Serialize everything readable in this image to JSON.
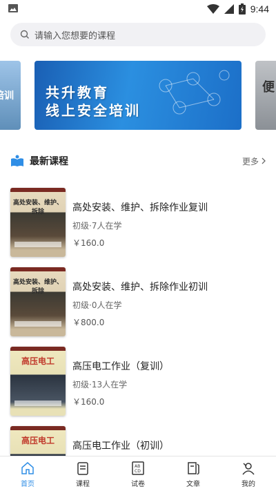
{
  "status_bar": {
    "time": "9:44"
  },
  "search": {
    "placeholder": "请输入您想要的课程"
  },
  "banner": {
    "line1": "共升教育",
    "line2": "线上安全培训",
    "left_peek_text": "培训",
    "right_peek_text": "便"
  },
  "section": {
    "title": "最新课程",
    "more": "更多"
  },
  "courses": [
    {
      "name": "高处安装、维护、拆除作业复训",
      "level": "初级",
      "learners": "·7人在学",
      "price": "￥160.0",
      "cover_title": "高处安装、维护、拆除"
    },
    {
      "name": "高处安装、维护、拆除作业初训",
      "level": "初级",
      "learners": "·0人在学",
      "price": "￥800.0",
      "cover_title": "高处安装、维护、拆除"
    },
    {
      "name": "高压电工作业（复训）",
      "level": "初级",
      "learners": "·13人在学",
      "price": "￥160.0",
      "cover_title": "高压电工"
    },
    {
      "name": "高压电工作业（初训）",
      "level": "",
      "learners": "",
      "price": "",
      "cover_title": "高压电工"
    }
  ],
  "tabs": [
    {
      "label": "首页",
      "icon": "home-icon",
      "active": true
    },
    {
      "label": "课程",
      "icon": "course-icon",
      "active": false
    },
    {
      "label": "试卷",
      "icon": "exam-icon",
      "active": false
    },
    {
      "label": "文章",
      "icon": "article-icon",
      "active": false
    },
    {
      "label": "我的",
      "icon": "profile-icon",
      "active": false
    }
  ],
  "colors": {
    "accent": "#2f8ee6",
    "banner": "#1a5fb4"
  }
}
